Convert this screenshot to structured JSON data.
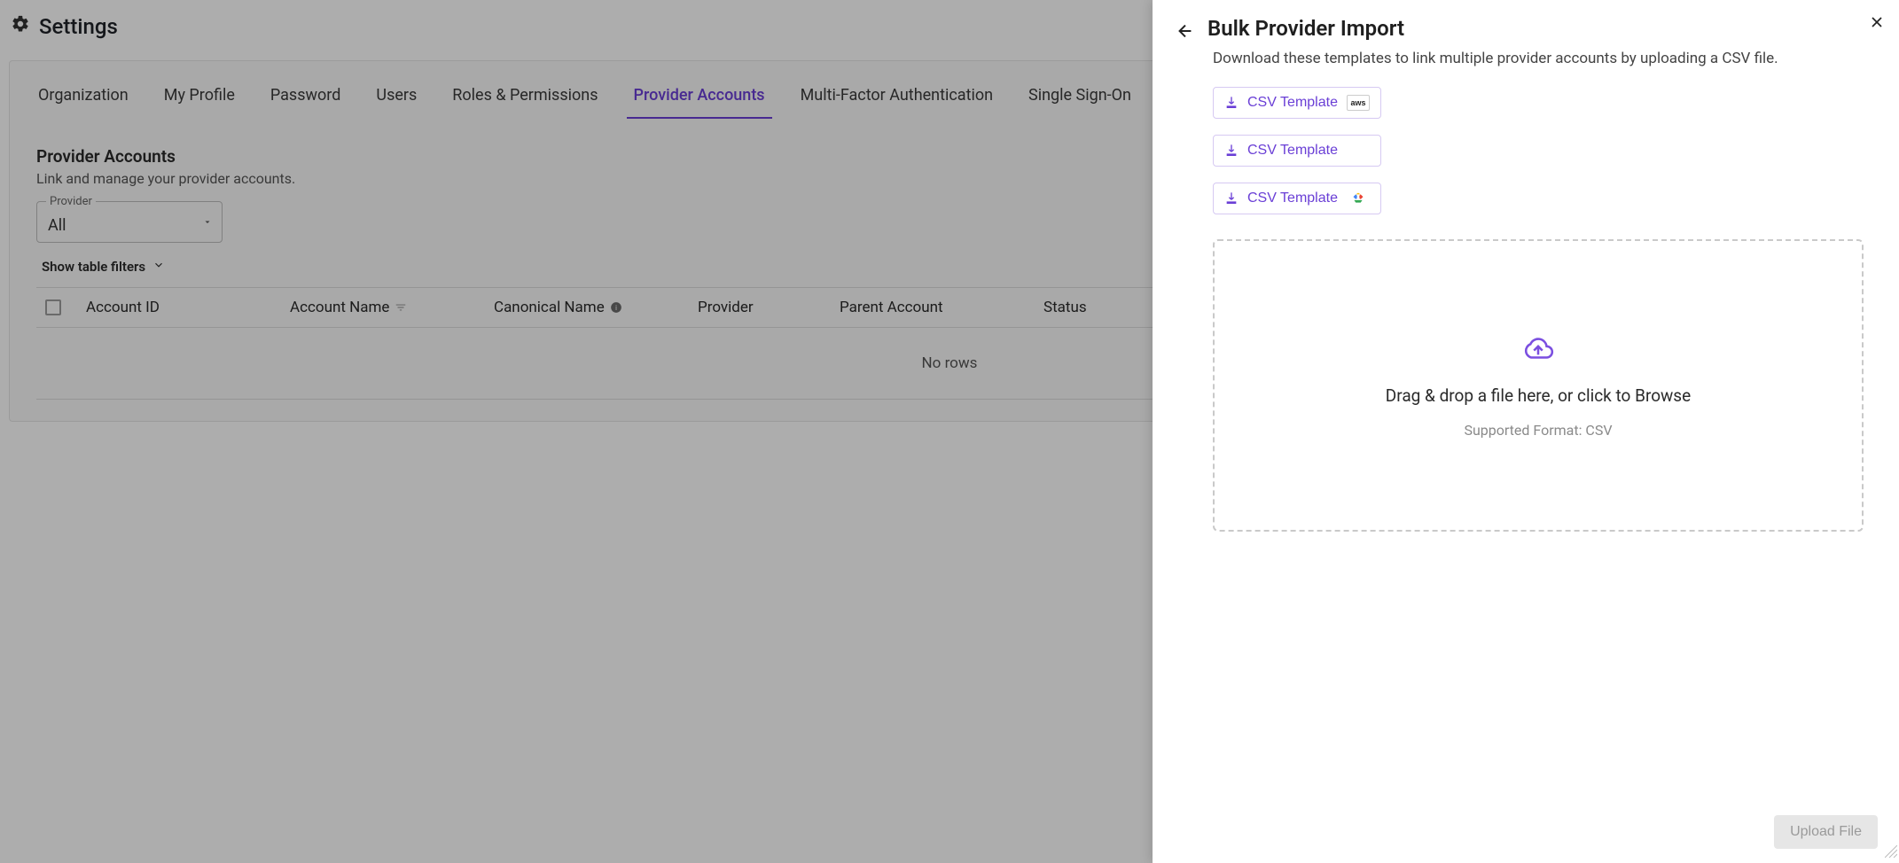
{
  "page": {
    "title": "Settings"
  },
  "tabs": [
    {
      "label": "Organization",
      "active": false
    },
    {
      "label": "My Profile",
      "active": false
    },
    {
      "label": "Password",
      "active": false
    },
    {
      "label": "Users",
      "active": false
    },
    {
      "label": "Roles & Permissions",
      "active": false
    },
    {
      "label": "Provider Accounts",
      "active": true
    },
    {
      "label": "Multi-Factor Authentication",
      "active": false
    },
    {
      "label": "Single Sign-On",
      "active": false
    }
  ],
  "section": {
    "title": "Provider Accounts",
    "subtitle": "Link and manage your provider accounts."
  },
  "filters": {
    "provider_label": "Provider",
    "provider_value": "All",
    "show_filters_label": "Show table filters"
  },
  "table": {
    "columns": {
      "account_id": "Account ID",
      "account_name": "Account Name",
      "canonical_name": "Canonical Name",
      "provider": "Provider",
      "parent_account": "Parent Account",
      "status": "Status"
    },
    "empty_text": "No rows"
  },
  "drawer": {
    "title": "Bulk Provider Import",
    "subtitle": "Download these templates to link multiple provider accounts by uploading a CSV file.",
    "templates": [
      {
        "label": "CSV Template",
        "provider": "aws"
      },
      {
        "label": "CSV Template",
        "provider": "azure"
      },
      {
        "label": "CSV Template",
        "provider": "gcp"
      }
    ],
    "dropzone": {
      "main": "Drag & drop a file here, or click to Browse",
      "sub": "Supported Format: CSV"
    },
    "upload_button": "Upload File"
  },
  "colors": {
    "accent": "#6a3fd6"
  }
}
